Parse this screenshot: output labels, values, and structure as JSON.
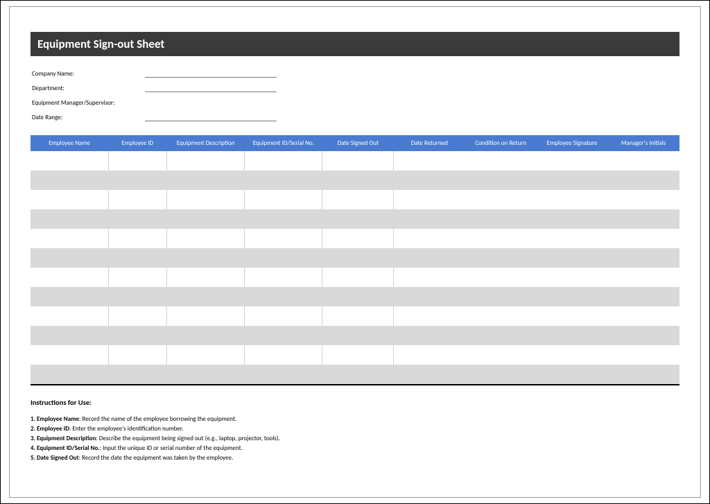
{
  "title": "Equipment Sign-out Sheet",
  "info": {
    "company_label": "Company Name:",
    "department_label": "Department:",
    "manager_label": "Equipment Manager/Supervisor:",
    "date_range_label": "Date Range:"
  },
  "columns": {
    "c0": "Employee Name",
    "c1": "Employee ID",
    "c2": "Equipment Description",
    "c3": "Equipment ID/Serial No.",
    "c4": "Date Signed Out",
    "c5": "Date Returned",
    "c6": "Condition on Return",
    "c7": "Employee Signature",
    "c8": "Manager's Initials"
  },
  "instructions": {
    "heading": "Instructions for Use:",
    "i1_b": "1. Employee Name",
    "i1_t": ": Record the name of the employee borrowing the equipment.",
    "i2_b": "2. Employee ID",
    "i2_t": ": Enter the employee's identification number.",
    "i3_b": "3. Equipment Description",
    "i3_t": ": Describe the equipment being signed out (e.g., laptop, projector, tools).",
    "i4_b": "4. Equipment ID/Serial No.",
    "i4_t": ": Input the unique ID or serial number of the equipment.",
    "i5_b": "5. Date Signed Out",
    "i5_t": ": Record the date the equipment was taken by the employee."
  }
}
